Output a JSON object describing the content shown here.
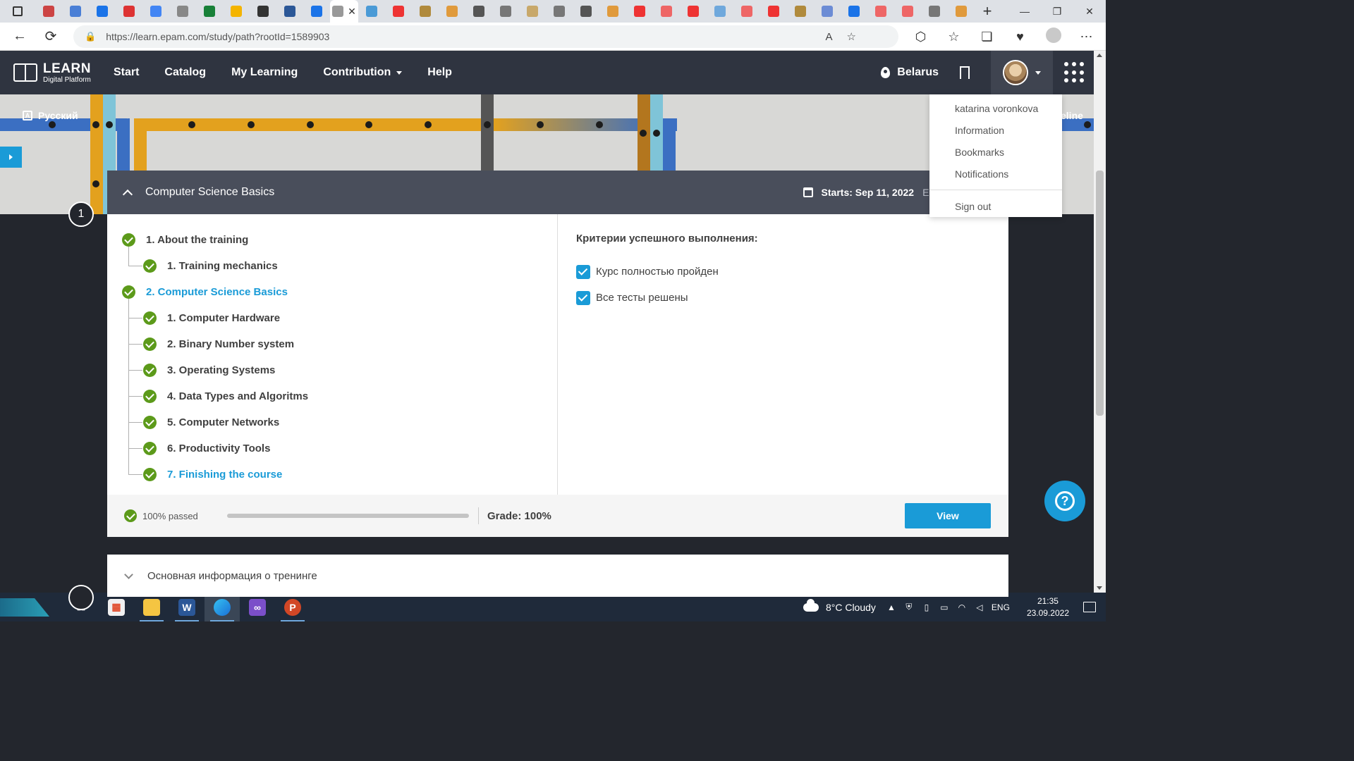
{
  "browser": {
    "url": "https://learn.epam.com/study/path?rootId=1589903",
    "tab_favicons": [
      "pdf-tab",
      "doc-tab",
      "chat-tab",
      "pdf-tab",
      "docs-tab",
      "dsh-tab",
      "sheets-tab",
      "drive-tab",
      "github-tab",
      "folder-tab",
      "edit-tab",
      "learn-tab",
      "ms-tab",
      "yandex-tab",
      "image-tab",
      "circle-tab",
      "zi-tab",
      "dark-tab",
      "stack-tab",
      "sp-tab",
      "e-tab",
      "circle-tab",
      "yandex-tab",
      "pdf-tab",
      "yandex-tab",
      "mail-tab",
      "pdf-tab",
      "yandex-tab",
      "image-tab",
      "arrow-tab",
      "edge-tab",
      "pdf-tab",
      "pdf-tab",
      "sp-tab",
      "circle-tab"
    ],
    "colors": {
      "tabstrip": "#dee1e6",
      "address_bg": "#f1f3f4"
    }
  },
  "header": {
    "logo_title": "LEARN",
    "logo_subtitle": "Digital Platform",
    "nav": [
      "Start",
      "Catalog",
      "My Learning",
      "Contribution",
      "Help"
    ],
    "location": "Belarus",
    "colors": {
      "bg": "#2f3440",
      "accent": "#1a9bd7"
    }
  },
  "banner": {
    "language": "Русский",
    "pipeline_label": "eline"
  },
  "user_menu": {
    "name": "katarina voronkova",
    "items": [
      "Information",
      "Bookmarks",
      "Notifications"
    ],
    "sign_out": "Sign out"
  },
  "course": {
    "step": "1",
    "title": "Computer Science Basics",
    "starts": "Starts: Sep 11, 2022",
    "ends": "Ends",
    "tree": [
      {
        "label": "1. About the training",
        "level": 1,
        "active": false,
        "done": true
      },
      {
        "label": "1. Training mechanics",
        "level": 2,
        "active": false,
        "done": true
      },
      {
        "label": "2. Computer Science Basics",
        "level": 1,
        "active": true,
        "done": true
      },
      {
        "label": "1. Computer Hardware",
        "level": 2,
        "active": false,
        "done": true
      },
      {
        "label": "2. Binary Number system",
        "level": 2,
        "active": false,
        "done": true
      },
      {
        "label": "3. Operating Systems",
        "level": 2,
        "active": false,
        "done": true
      },
      {
        "label": "4. Data Types and Algoritms",
        "level": 2,
        "active": false,
        "done": true
      },
      {
        "label": "5. Computer Networks",
        "level": 2,
        "active": false,
        "done": true
      },
      {
        "label": "6. Productivity Tools",
        "level": 2,
        "active": false,
        "done": true
      },
      {
        "label": "7. Finishing the course",
        "level": 2,
        "active": true,
        "done": true
      }
    ],
    "criteria_title": "Критерии успешного выполнения:",
    "criteria": [
      {
        "label": "Курс полностью пройден",
        "checked": true
      },
      {
        "label": "Все тесты решены",
        "checked": true
      }
    ],
    "passed": "100% passed",
    "progress_fraction": 1.0,
    "grade": "Grade: 100%",
    "view_label": "View"
  },
  "second_card": {
    "title": "Основная информация о тренинге"
  },
  "taskbar": {
    "apps": [
      "task-view",
      "store",
      "file-explorer",
      "word",
      "edge",
      "visual-studio",
      "powerpoint"
    ],
    "weather": "8°C  Cloudy",
    "lang": "ENG",
    "time": "21:35",
    "date": "23.09.2022"
  }
}
